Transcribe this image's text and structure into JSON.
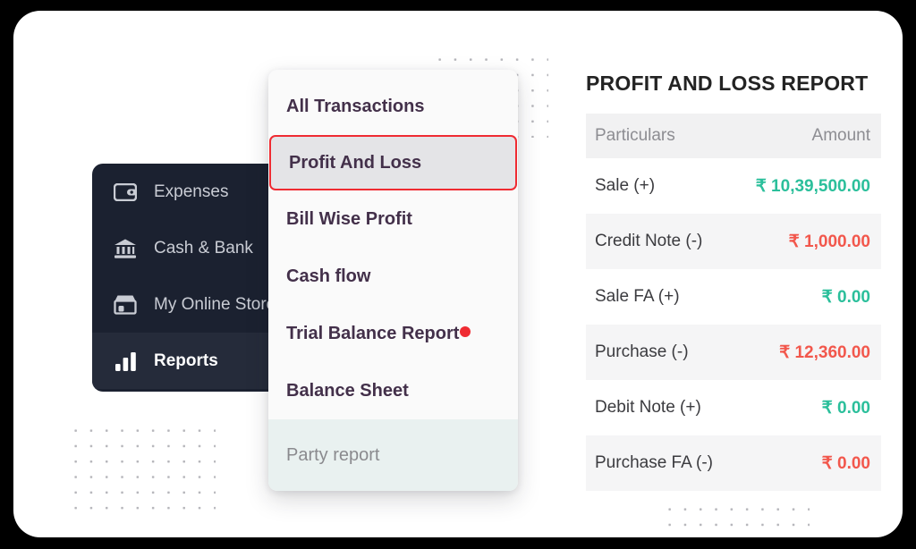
{
  "sidebar": {
    "items": [
      {
        "label": "Expenses",
        "icon": "wallet-icon",
        "active": false
      },
      {
        "label": "Cash & Bank",
        "icon": "bank-icon",
        "active": false
      },
      {
        "label": "My Online Store",
        "icon": "storefront-icon",
        "active": false
      },
      {
        "label": "Reports",
        "icon": "bar-chart-icon",
        "active": true
      }
    ]
  },
  "menu": {
    "items": [
      {
        "label": "All Transactions",
        "selected": false,
        "badge": false
      },
      {
        "label": "Profit And Loss",
        "selected": true,
        "badge": false
      },
      {
        "label": "Bill Wise Profit",
        "selected": false,
        "badge": false
      },
      {
        "label": "Cash flow",
        "selected": false,
        "badge": false
      },
      {
        "label": "Trial Balance Report",
        "selected": false,
        "badge": true
      },
      {
        "label": "Balance Sheet",
        "selected": false,
        "badge": false
      }
    ],
    "footer_label": "Party report",
    "selected_border_color": "#ef2b32",
    "badge_color": "#ef2b32"
  },
  "report": {
    "title": "PROFIT AND LOSS REPORT",
    "columns": [
      "Particulars",
      "Amount"
    ],
    "rows": [
      {
        "particulars": "Sale (+)",
        "amount": "₹ 10,39,500.00",
        "sign": "pos"
      },
      {
        "particulars": "Credit Note (-)",
        "amount": "₹ 1,000.00",
        "sign": "neg"
      },
      {
        "particulars": "Sale FA (+)",
        "amount": "₹ 0.00",
        "sign": "pos"
      },
      {
        "particulars": "Purchase (-)",
        "amount": "₹ 12,360.00",
        "sign": "neg"
      },
      {
        "particulars": "Debit Note (+)",
        "amount": "₹ 0.00",
        "sign": "pos"
      },
      {
        "particulars": "Purchase FA (-)",
        "amount": "₹ 0.00",
        "sign": "neg"
      }
    ],
    "positive_color": "#2bbf9b",
    "negative_color": "#f2574c"
  }
}
